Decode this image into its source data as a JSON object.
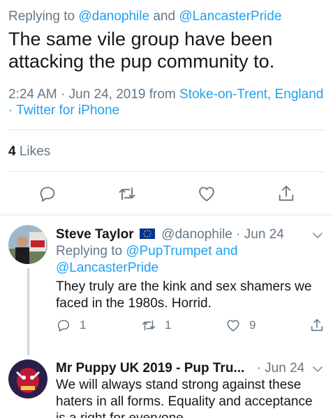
{
  "main_tweet": {
    "replying_prefix": "Replying to",
    "replying_user1": "@danophile",
    "replying_and": "and",
    "replying_user2": "@LancasterPride",
    "text": "The same vile group have been attacking the pup community to.",
    "time": "2:24 AM · Jun 24, 2019 from",
    "location": "Stoke-on-Trent, England",
    "client": "· Twitter for iPhone",
    "likes_count": "4",
    "likes_label": "Likes"
  },
  "actions": {
    "reply_icon": "reply-icon",
    "retweet_icon": "retweet-icon",
    "like_icon": "heart-icon",
    "share_icon": "share-icon"
  },
  "replies": [
    {
      "name": "Steve Taylor",
      "handle": "@danophile",
      "date": "· Jun 24",
      "replying_prefix": "Replying to",
      "replying_user1": "@PupTrumpet",
      "replying_and": "and",
      "replying_user2": "@LancasterPride",
      "text": "They truly are the kink and sex shamers we faced in the 1980s. Horrid.",
      "reply_count": "1",
      "retweet_count": "1",
      "like_count": "9"
    },
    {
      "name": "Mr Puppy UK 2019 - Pup Tru...",
      "date": "· Jun 24",
      "text": "We will always stand strong against these haters in all forms. Equality and acceptance is a right for everyone."
    }
  ],
  "colors": {
    "link": "#1da1f2",
    "secondary": "#657786",
    "primary": "#14171a",
    "divider": "#e1e8ed"
  }
}
